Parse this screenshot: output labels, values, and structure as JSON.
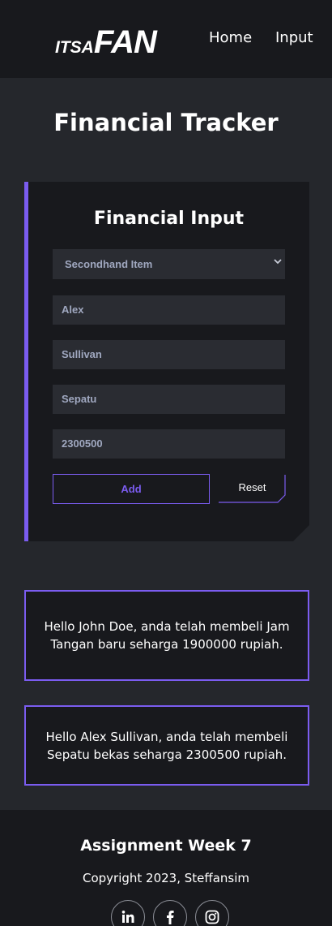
{
  "header": {
    "logo_small": "ITSA",
    "logo_big": "FAN",
    "nav": [
      "Home",
      "Input"
    ]
  },
  "page_title": "Financial Tracker",
  "form": {
    "title": "Financial Input",
    "select_value": "Secondhand Item",
    "first_name": "Alex",
    "last_name": "Sullivan",
    "item": "Sepatu",
    "price": "2300500",
    "add_label": "Add",
    "reset_label": "Reset"
  },
  "messages": [
    "Hello John Doe, anda telah membeli Jam Tangan baru seharga 1900000 rupiah.",
    "Hello Alex Sullivan, anda telah membeli Sepatu bekas seharga 2300500 rupiah."
  ],
  "footer": {
    "title": "Assignment Week 7",
    "copyright": "Copyright 2023, Steffansim"
  },
  "icons": {
    "social": [
      "linkedin-icon",
      "facebook-icon",
      "instagram-icon"
    ]
  },
  "colors": {
    "accent": "#7b5cf0",
    "background": "#25272c",
    "panel": "#18191d",
    "field": "#2a2c32"
  }
}
